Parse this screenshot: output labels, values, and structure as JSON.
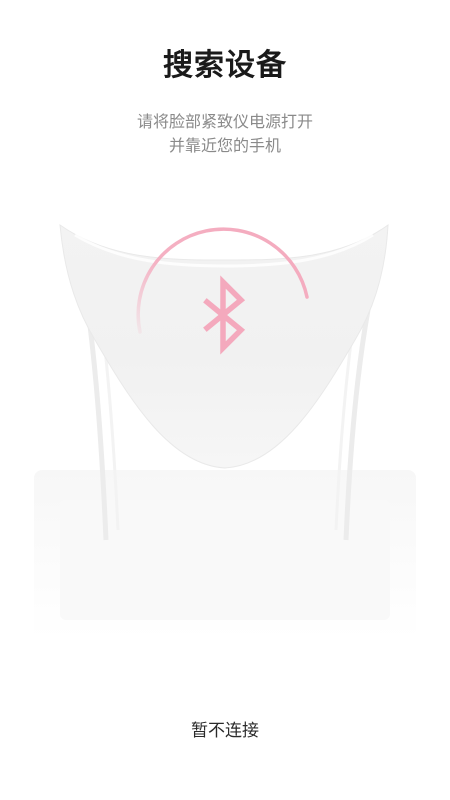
{
  "header": {
    "title": "搜索设备",
    "instructions": {
      "line1": "请将脸部紧致仪电源打开",
      "line2": "并靠近您的手机"
    }
  },
  "illustration": {
    "device": "face-mask-device",
    "icon": "bluetooth-icon",
    "state": "searching",
    "accent_color": "#f4a9bd"
  },
  "footer": {
    "skip_label": "暂不连接"
  }
}
